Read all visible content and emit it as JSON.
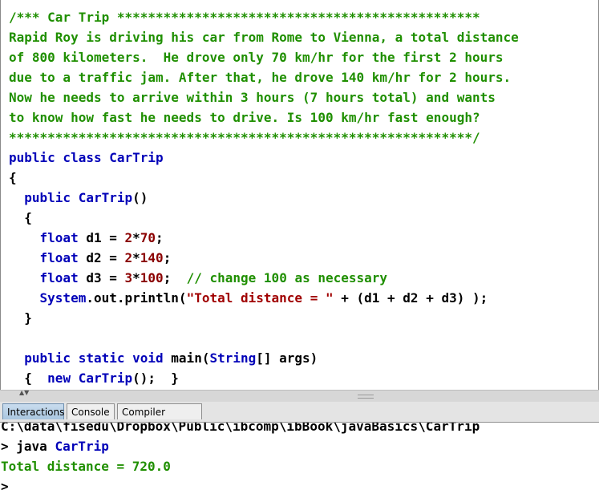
{
  "editor": {
    "lines": [
      [
        {
          "t": "/*** Car Trip ***********************************************",
          "c": "cmt"
        }
      ],
      [
        {
          "t": "Rapid Roy is driving his car from Rome to Vienna, a total distance",
          "c": "cmt"
        }
      ],
      [
        {
          "t": "of 800 kilometers.  He drove only 70 km/hr for the first 2 hours",
          "c": "cmt"
        }
      ],
      [
        {
          "t": "due to a traffic jam. After that, he drove 140 km/hr for 2 hours.",
          "c": "cmt"
        }
      ],
      [
        {
          "t": "Now he needs to arrive within 3 hours (7 hours total) and wants",
          "c": "cmt"
        }
      ],
      [
        {
          "t": "to know how fast he needs to drive. Is 100 km/hr fast enough?",
          "c": "cmt"
        }
      ],
      [
        {
          "t": "************************************************************/",
          "c": "cmt"
        }
      ],
      [
        {
          "t": "public class CarTrip",
          "c": "kw"
        }
      ],
      [
        {
          "t": "{",
          "c": "pl"
        }
      ],
      [
        {
          "t": "  public CarTrip",
          "c": "kw"
        },
        {
          "t": "()",
          "c": "pl"
        }
      ],
      [
        {
          "t": "  {",
          "c": "pl"
        }
      ],
      [
        {
          "t": "    float",
          "c": "kw"
        },
        {
          "t": " d1 = ",
          "c": "pl"
        },
        {
          "t": "2",
          "c": "num"
        },
        {
          "t": "*",
          "c": "pl"
        },
        {
          "t": "70",
          "c": "num"
        },
        {
          "t": ";",
          "c": "pl"
        }
      ],
      [
        {
          "t": "    float",
          "c": "kw"
        },
        {
          "t": " d2 = ",
          "c": "pl"
        },
        {
          "t": "2",
          "c": "num"
        },
        {
          "t": "*",
          "c": "pl"
        },
        {
          "t": "140",
          "c": "num"
        },
        {
          "t": ";",
          "c": "pl"
        }
      ],
      [
        {
          "t": "    float",
          "c": "kw"
        },
        {
          "t": " d3 = ",
          "c": "pl"
        },
        {
          "t": "3",
          "c": "num"
        },
        {
          "t": "*",
          "c": "pl"
        },
        {
          "t": "100",
          "c": "num"
        },
        {
          "t": ";  ",
          "c": "pl"
        },
        {
          "t": "// change 100 as necessary",
          "c": "cmt"
        }
      ],
      [
        {
          "t": "    System",
          "c": "kw"
        },
        {
          "t": ".out.println(",
          "c": "pl"
        },
        {
          "t": "\"Total distance = \"",
          "c": "str"
        },
        {
          "t": " + (d1 + d2 + d3) );",
          "c": "pl"
        }
      ],
      [
        {
          "t": "  }",
          "c": "pl"
        }
      ],
      [
        {
          "t": "",
          "c": "pl"
        }
      ],
      [
        {
          "t": "  public static void",
          "c": "kw"
        },
        {
          "t": " main(",
          "c": "pl"
        },
        {
          "t": "String",
          "c": "kw"
        },
        {
          "t": "[] args)",
          "c": "pl"
        }
      ],
      [
        {
          "t": "  {  ",
          "c": "pl"
        },
        {
          "t": "new CarTrip",
          "c": "kw"
        },
        {
          "t": "();  }",
          "c": "pl"
        }
      ]
    ]
  },
  "tabs": [
    "Interactions",
    "Console",
    "Compiler Output"
  ],
  "active_tab": "Interactions",
  "interactions": {
    "path_line": "C:\\data\\fisedu\\Dropbox\\Public\\ibcomp\\ibBook\\javaBasics\\CarTrip",
    "prompt": ">",
    "command": "java",
    "class_name": "CarTrip",
    "output": "Total distance = 720.0",
    "prompt_empty": ">"
  },
  "colors": {
    "comment": "#1f8f00",
    "keyword": "#0000b8",
    "number": "#8b0000",
    "string": "#a00000"
  }
}
